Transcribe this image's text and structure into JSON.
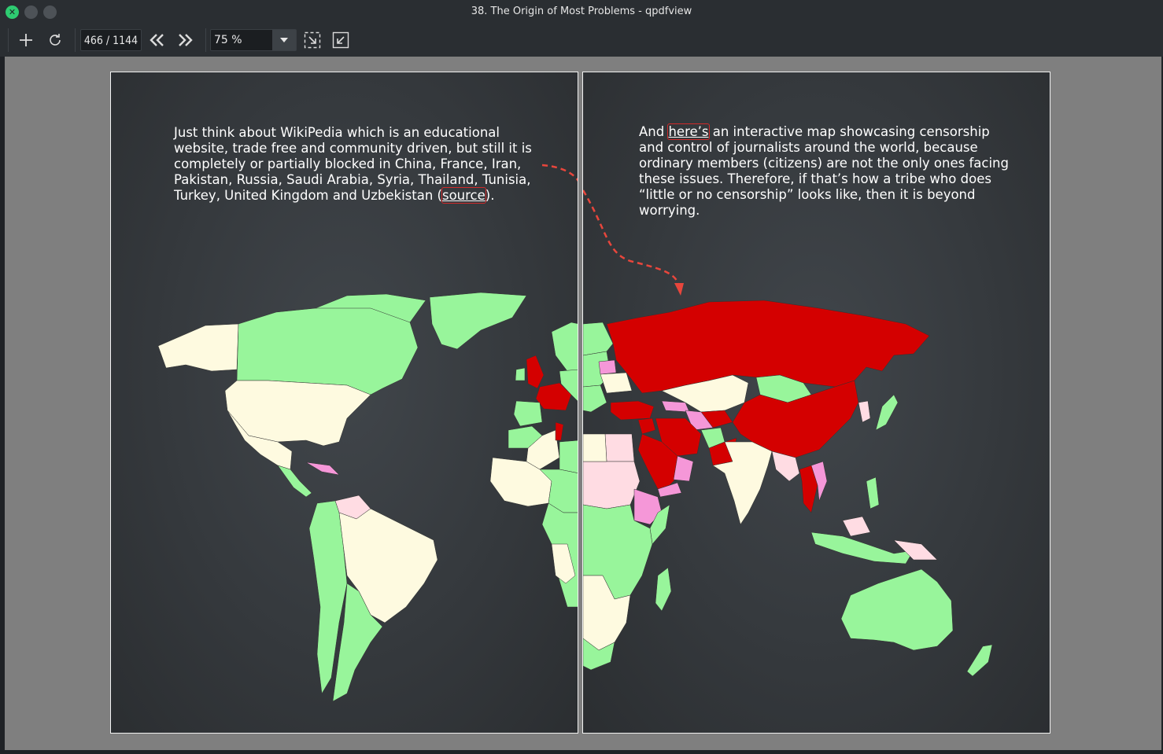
{
  "window": {
    "title": "38. The Origin of Most Problems - qpdfview",
    "close_symbol": "✕"
  },
  "toolbar": {
    "page_indicator": "466 / 1144",
    "zoom_value": "75 %",
    "icons": [
      "plus-icon",
      "refresh-icon",
      "previous-page-icon",
      "next-page-icon",
      "zoom-dropdown-arrow-icon",
      "fit-to-page-icon",
      "fit-to-width-icon"
    ]
  },
  "pages": {
    "left": {
      "text_before_link": "Just think about WikiPedia which is an educational website, trade free and community driven, but still it is completely or partially blocked in China, France, Iran, Pakistan, Russia, Saudi Arabia, Syria, Thailand, Tunisia, Turkey, United Kingdom and Uzbekistan (",
      "link_text": "source",
      "text_after_link": ")."
    },
    "right": {
      "text_before_link": "And ",
      "link_text": "here’s",
      "text_after_link": " an interactive map showcasing censorship and control of journalists around the world, because ordinary members (citizens) are not the only ones facing these issues. Therefore, if that’s how a tribe who does “little or no censorship” looks like, then it is beyond worrying."
    }
  },
  "colors": {
    "viewport_bg": "#7f7f7f",
    "page_bg": "#36393d",
    "map_green": "#98f59b",
    "map_cream": "#fefae0",
    "map_red": "#d40000",
    "map_pink": "#ffdce3",
    "map_magenta": "#f597d8",
    "arrow_red": "#e8463c"
  }
}
